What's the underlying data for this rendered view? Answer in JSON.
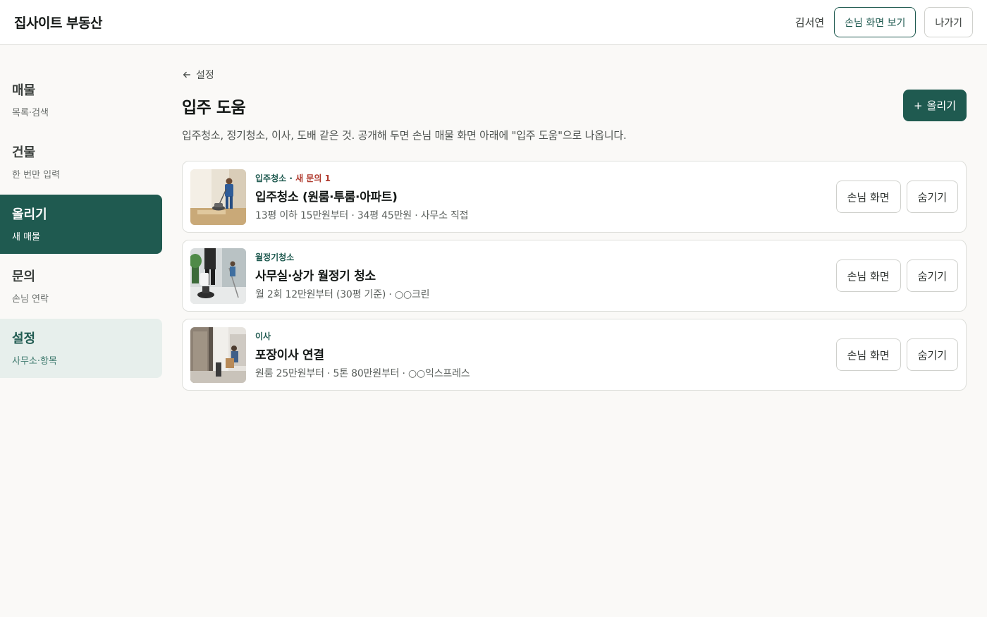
{
  "header": {
    "brand": "집사이트 부동산",
    "user_name": "김서연",
    "customer_view_label": "손님 화면 보기",
    "logout_label": "나가기"
  },
  "sidebar": {
    "items": [
      {
        "title": "매물",
        "sub": "목록·검색"
      },
      {
        "title": "건물",
        "sub": "한 번만 입력"
      },
      {
        "title": "올리기",
        "sub": "새 매물"
      },
      {
        "title": "문의",
        "sub": "손님 연락"
      },
      {
        "title": "설정",
        "sub": "사무소·항목"
      }
    ]
  },
  "main": {
    "back_label": "설정",
    "title": "입주 도움",
    "add_label": "올리기",
    "description": "입주청소, 정기청소, 이사, 도배 같은 것. 공개해 두면 손님 매물 화면 아래에 \"입주 도움\"으로 나옵니다.",
    "services": [
      {
        "category": "입주청소",
        "separator": " · ",
        "new_badge": "새 문의 1",
        "title": "입주청소 (원룸·투룸·아파트)",
        "meta": "13평 이하 15만원부터 · 34평 45만원 · 사무소 직접",
        "view_label": "손님 화면",
        "hide_label": "숨기기",
        "thumb_icon": "floor-cleaning-photo"
      },
      {
        "category": "월정기청소",
        "separator": "",
        "new_badge": "",
        "title": "사무실·상가 월정기 청소",
        "meta": "월 2회 12만원부터 (30평 기준) · ○○크린",
        "view_label": "손님 화면",
        "hide_label": "숨기기",
        "thumb_icon": "office-cleaning-photo"
      },
      {
        "category": "이사",
        "separator": "",
        "new_badge": "",
        "title": "포장이사 연결",
        "meta": "원룸 25만원부터 · 5톤 80만원부터 · ○○익스프레스",
        "view_label": "손님 화면",
        "hide_label": "숨기기",
        "thumb_icon": "moving-photo"
      }
    ]
  },
  "colors": {
    "primary": "#1f5a50",
    "new_badge": "#b03a2e",
    "selected_bg": "#e7efec"
  }
}
